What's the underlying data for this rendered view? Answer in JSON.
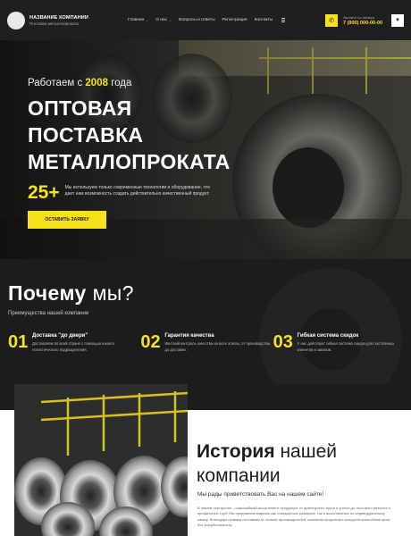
{
  "header": {
    "company_name": "Название компании",
    "company_tagline": "Поставка металлопроката",
    "nav": [
      {
        "label": "Главная",
        "has_dropdown": true
      },
      {
        "label": "О нас",
        "has_dropdown": true
      },
      {
        "label": "Вопросы и ответы",
        "has_dropdown": false
      },
      {
        "label": "Регистрация",
        "has_dropdown": false
      },
      {
        "label": "Контакты",
        "has_dropdown": false
      }
    ],
    "phone_label": "Звоните по номеру",
    "phone_number": "7 (900) 000-00-00",
    "icons": {
      "phone": "phone-icon",
      "cart": "cart-icon",
      "menu": "hamburger-icon"
    }
  },
  "hero": {
    "since_prefix": "Работаем с",
    "since_year": "2008",
    "since_suffix": "года",
    "title_line1": "Оптовая поставка",
    "title_line2": "металлопроката",
    "stat": "25+",
    "description": "Мы используем только современные технологии и оборудование, что дает нам возможность создать действительно качественный продукт.",
    "cta_label": "Оставить заявку",
    "prev_label": "◀",
    "next_label": "▶"
  },
  "why": {
    "title_bold": "Почему",
    "title_rest": "мы?",
    "subtitle": "Преимущества нашей компании",
    "benefits": [
      {
        "num": "01",
        "title": "Доставка \"до двери\"",
        "text": "Доставляем по всей стране с помощью нашего логистического подразделения."
      },
      {
        "num": "02",
        "title": "Гарантия качества",
        "text": "Жесткий контроль качества на всех этапах, от производства до доставки."
      },
      {
        "num": "03",
        "title": "Гибкая система скидок",
        "text": "У нас действует гибкая система скидок для постоянных клиентов и заказов."
      }
    ]
  },
  "history": {
    "title_bold": "История",
    "title_rest1": "нашей",
    "title_rest2": "компании",
    "welcome": "Мы рады приветствовать Вас на нашем сайте!",
    "text": "В нашем портфолио – широчайший ассортимент продукции: от арматурного прута и уголка до листового металла и профильных труб. Мы предлагаем изделия как стандартных размеров, так и выполненные по индивидуальному заказу. Благодаря прямым поставкам от лучших производителей, компания предлагает конкурентоспособные цены без ущерба качеству."
  },
  "colors": {
    "accent": "#f7e11a",
    "dark": "#1c1c1c",
    "light": "#ffffff"
  }
}
